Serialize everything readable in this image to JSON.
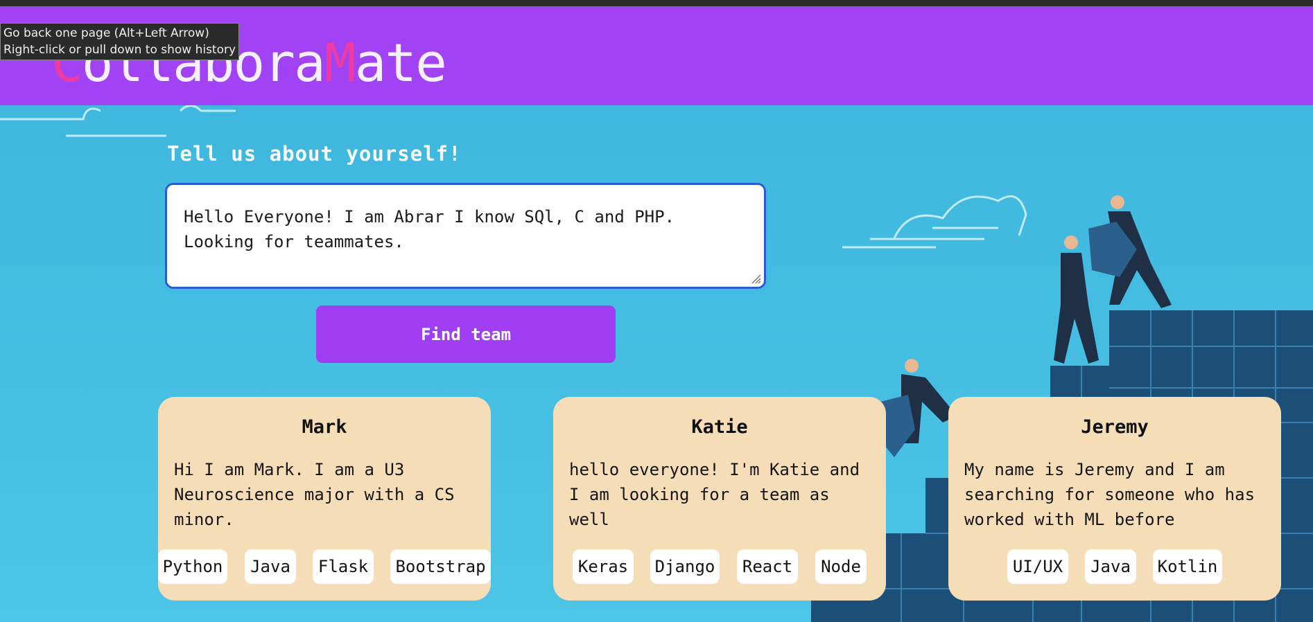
{
  "colors": {
    "header_bg": "#a142f4",
    "accent_pink": "#f03aa0",
    "button_bg": "#9f3ef3",
    "card_bg": "#f5ddb8",
    "page_bg": "#41b9df"
  },
  "header": {
    "logo_part1": "C",
    "logo_part2": "ollabora",
    "logo_part3": "M",
    "logo_part4": "ate"
  },
  "tooltip": {
    "line1": "Go back one page (Alt+Left Arrow)",
    "line2": "Right-click or pull down to show history"
  },
  "form": {
    "heading": "Tell us about yourself!",
    "bio_value": "Hello Everyone! I am Abrar I know SQl, C and PHP.\nLooking for teammates.",
    "submit_label": "Find team"
  },
  "cards": [
    {
      "name": "Mark",
      "description": "Hi I am Mark. I am a U3 Neuroscience major with a CS minor.",
      "tags": [
        "Python",
        "Java",
        "Flask",
        "Bootstrap"
      ]
    },
    {
      "name": "Katie",
      "description": "hello everyone! I'm Katie and I am looking for a team as well",
      "tags": [
        "Keras",
        "Django",
        "React",
        "Node"
      ]
    },
    {
      "name": "Jeremy",
      "description": "My name is Jeremy and I am searching for someone who has worked with ML before",
      "tags": [
        "UI/UX",
        "Java",
        "Kotlin"
      ]
    }
  ]
}
